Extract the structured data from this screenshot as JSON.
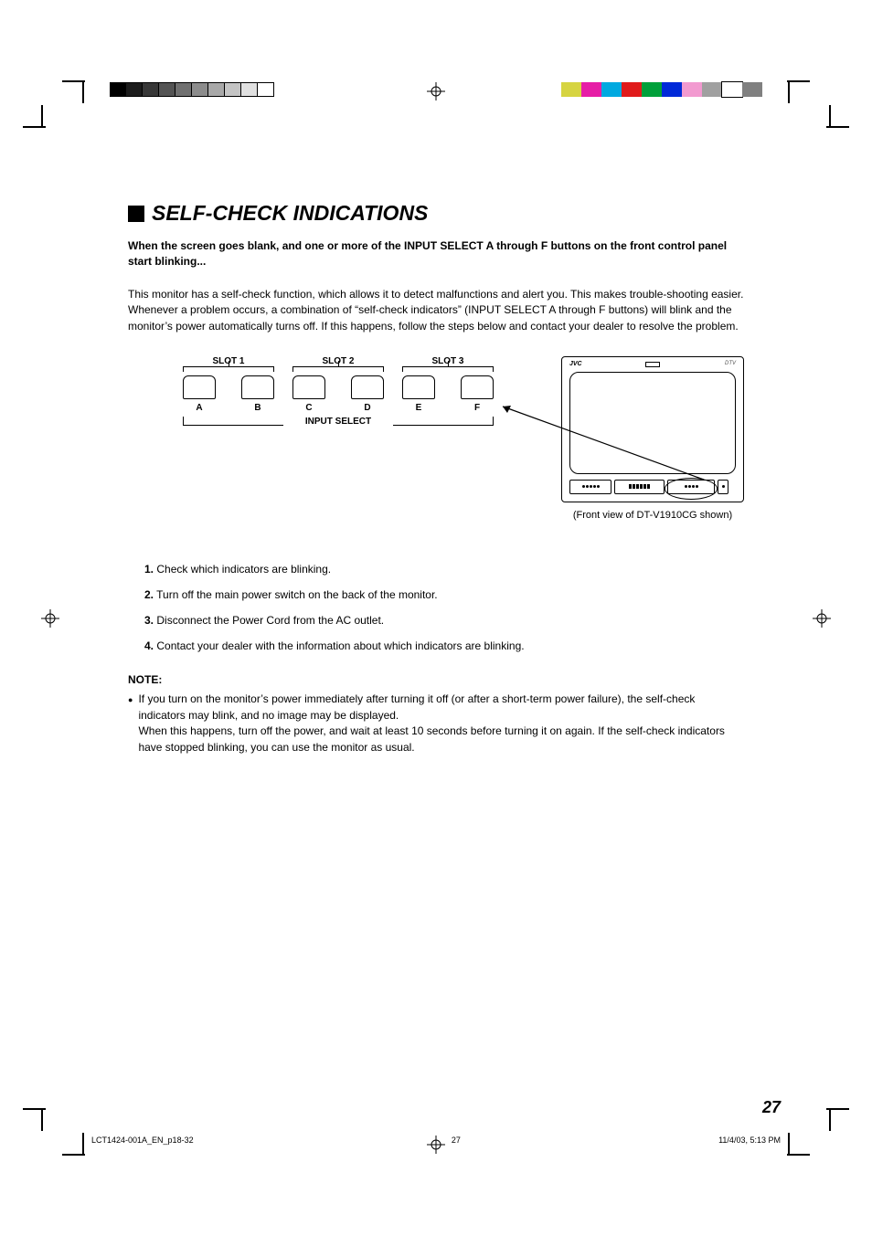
{
  "title": "SELF-CHECK INDICATIONS",
  "lead": "When the screen goes blank, and one or more of the INPUT SELECT A through F buttons on the front control panel start blinking...",
  "intro": "This monitor has a self-check function, which allows it to detect malfunctions and alert you. This makes trouble-shooting easier. Whenever a problem occurs, a combination of “self-check indicators” (INPUT SELECT A through F buttons) will blink and the monitor’s power automatically turns off. If this happens, follow the steps below and contact your dealer to resolve the problem.",
  "slots": {
    "s1": "SLOT 1",
    "s2": "SLOT 2",
    "s3": "SLOT 3"
  },
  "letters": {
    "a": "A",
    "b": "B",
    "c": "C",
    "d": "D",
    "e": "E",
    "f": "F"
  },
  "input_select_label": "INPUT SELECT",
  "monitor": {
    "brand_left": "JVC",
    "brand_right": "DTV",
    "caption": "(Front view of DT-V1910CG shown)"
  },
  "steps": {
    "n1": "1.",
    "t1": "Check which indicators are blinking.",
    "n2": "2.",
    "t2": "Turn off the main power switch on the back of the monitor.",
    "n3": "3.",
    "t3": "Disconnect the Power Cord from the AC outlet.",
    "n4": "4.",
    "t4": "Contact your dealer with the information about which indicators are blinking."
  },
  "note": {
    "title": "NOTE:",
    "line1": "If you turn on the monitor’s power immediately after turning it off (or after a short-term power failure), the self-check indicators may blink, and no image may be displayed.",
    "line2": "When this happens, turn off the power, and wait at least 10 seconds before turning it on again.  If the self-check indicators have stopped blinking, you can use the monitor as usual."
  },
  "page_number": "27",
  "footer": {
    "left": "LCT1424-001A_EN_p18-32",
    "mid": "27",
    "right": "11/4/03, 5:13 PM"
  },
  "greyscale": [
    "#000000",
    "#1c1c1c",
    "#383838",
    "#545454",
    "#707070",
    "#8c8c8c",
    "#a8a8a8",
    "#c4c4c4",
    "#e0e0e0",
    "#ffffff"
  ],
  "colorbar": [
    "#d6d441",
    "#e61ea6",
    "#00a9e0",
    "#e01b1b",
    "#00a03a",
    "#0029d8",
    "#f29ad0",
    "#a0a0a0",
    "#ffffff",
    "#808080"
  ]
}
